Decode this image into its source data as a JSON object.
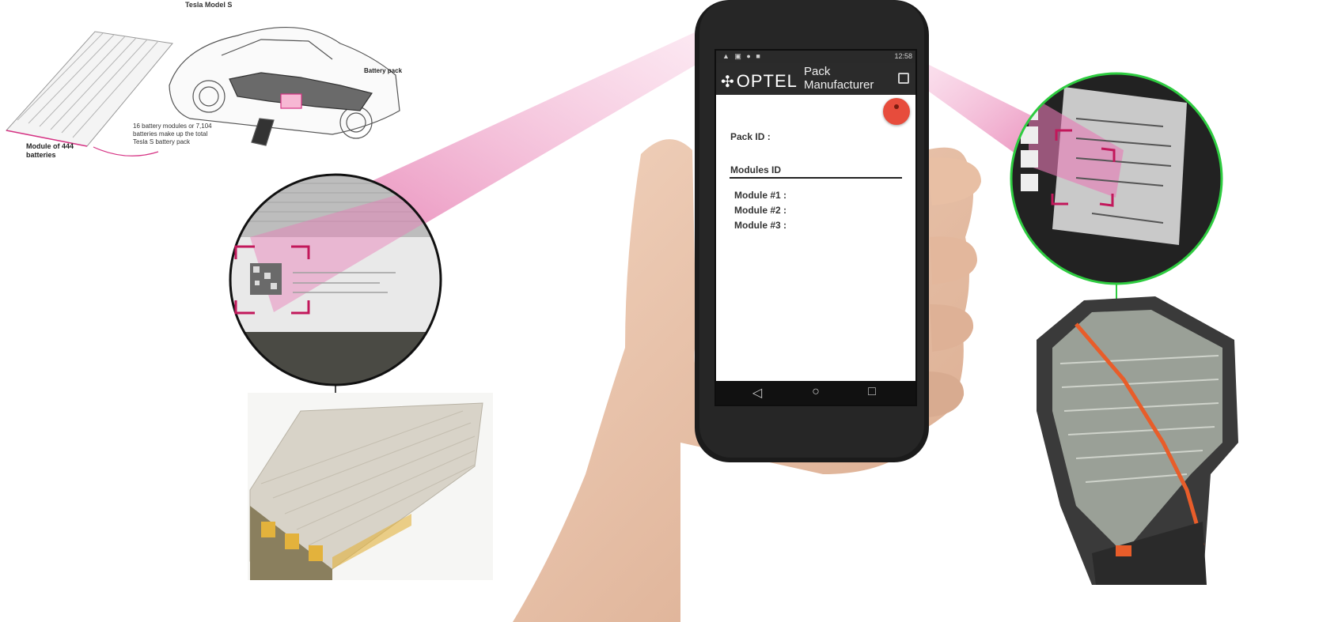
{
  "diagram": {
    "title": "Tesla Model S",
    "module_label": "Module of 444 batteries",
    "pack_label": "Battery pack",
    "caption": "16 battery modules or 7,104 batteries make up the total Tesla S battery pack"
  },
  "phone": {
    "logo": "OPTEL",
    "logo_glyph": "✣",
    "app_title": "Pack Manufacturer",
    "status_left": "▲ ▣ ● ■",
    "status_right": "12:58",
    "pack_id_label": "Pack ID :",
    "modules_heading": "Modules ID",
    "modules": [
      "Module #1 :",
      "Module #2 :",
      "Module #3 :"
    ],
    "nav": {
      "back": "◁",
      "home": "○",
      "recent": "□"
    }
  },
  "colors": {
    "scan_beam": "#e0559a",
    "scan_frame": "#c2185b",
    "highlight_ring": "#2ecc40",
    "fab": "#e74c3c",
    "appbar": "#2b2b2b"
  }
}
